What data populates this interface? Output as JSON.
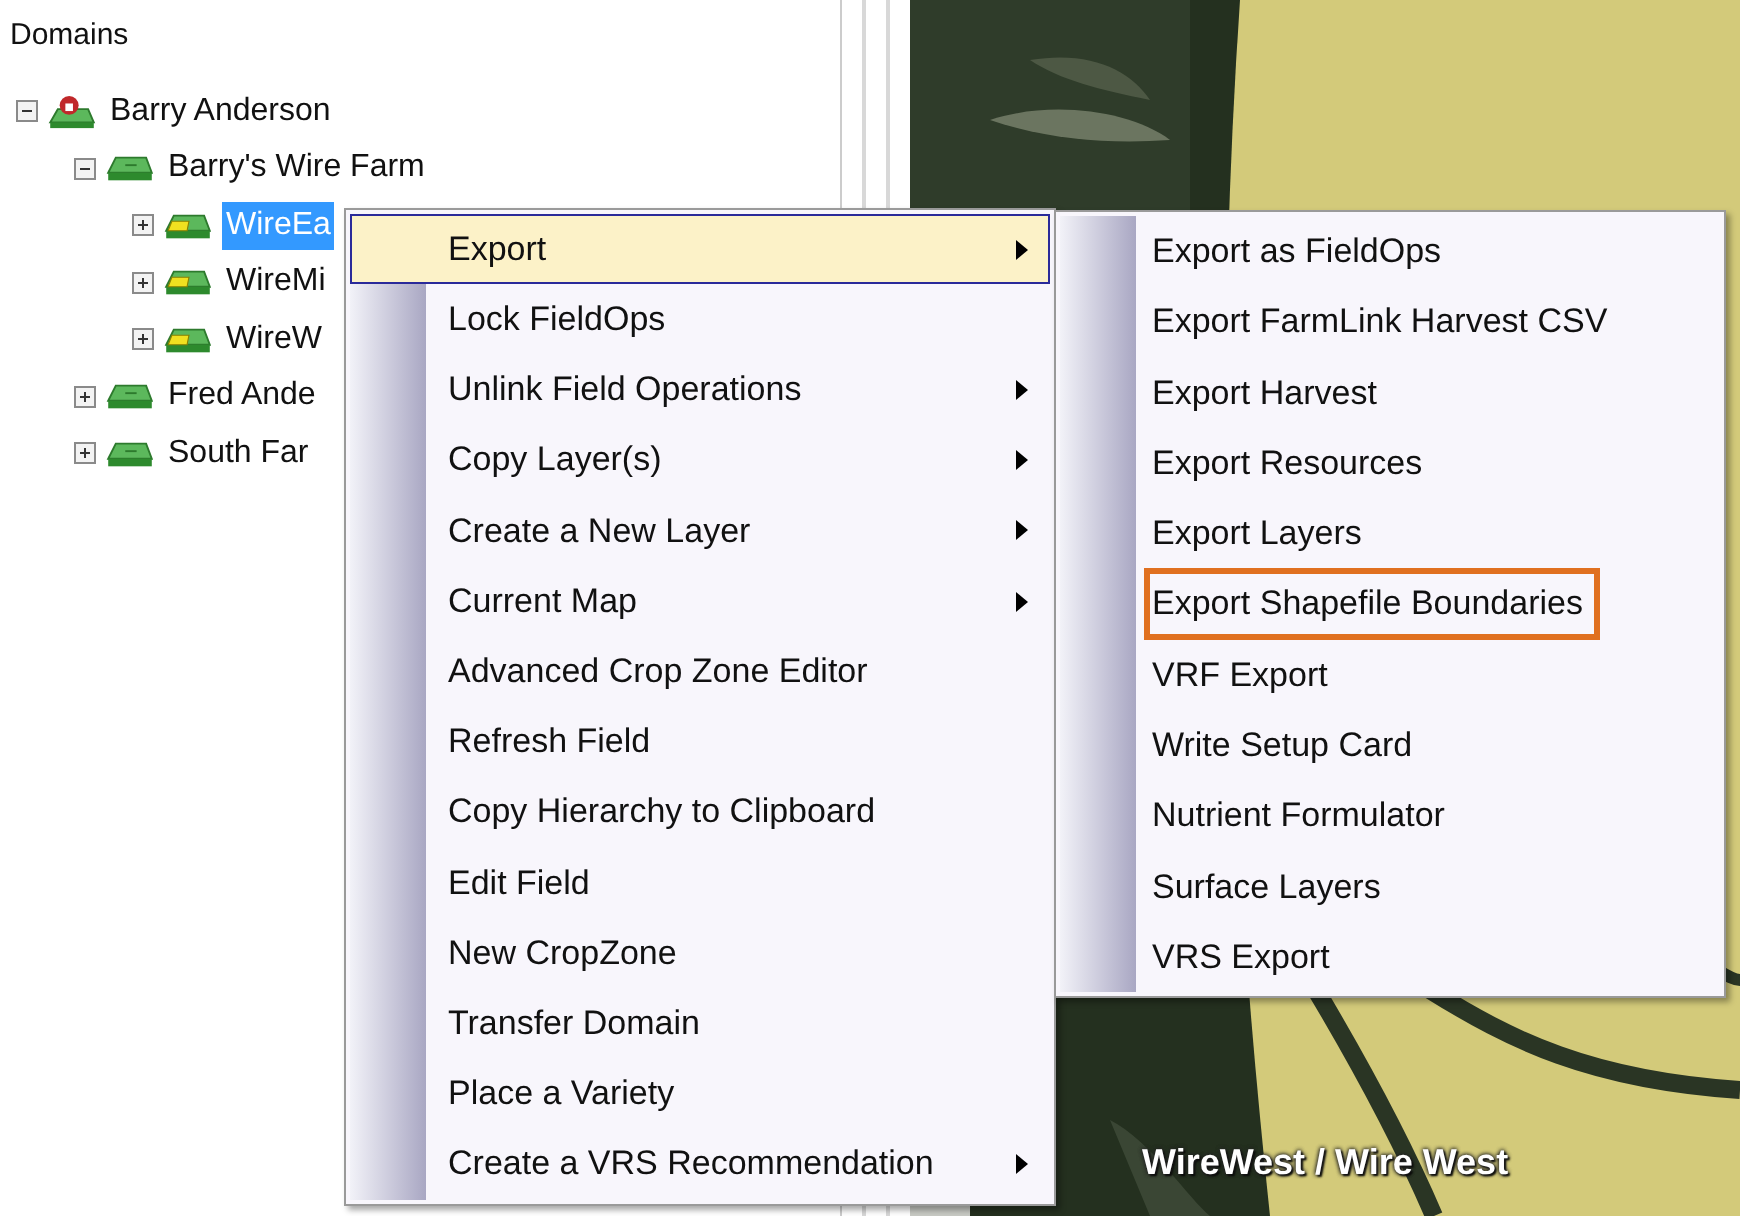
{
  "tree": {
    "title": "Domains",
    "nodes": [
      {
        "label": "Barry Anderson",
        "kind": "grower",
        "expanded": true,
        "selected": false,
        "children": [
          {
            "label": "Barry's Wire Farm",
            "kind": "farm",
            "expanded": true,
            "selected": false,
            "children": [
              {
                "label": "WireEa",
                "kind": "field",
                "expanded": false,
                "selected": true
              },
              {
                "label": "WireMi",
                "kind": "field",
                "expanded": false,
                "selected": false
              },
              {
                "label": "WireW",
                "kind": "field",
                "expanded": false,
                "selected": false
              }
            ]
          },
          {
            "label": "Fred Ande",
            "kind": "farm",
            "expanded": false,
            "selected": false
          },
          {
            "label": "South Far",
            "kind": "farm",
            "expanded": false,
            "selected": false
          }
        ]
      }
    ]
  },
  "context_menu": {
    "items": [
      {
        "label": "Export",
        "submenu": true,
        "selected": true
      },
      {
        "label": "Lock FieldOps",
        "submenu": false,
        "selected": false
      },
      {
        "label": "Unlink Field Operations",
        "submenu": true,
        "selected": false
      },
      {
        "label": "Copy Layer(s)",
        "submenu": true,
        "selected": false
      },
      {
        "label": "Create a New Layer",
        "submenu": true,
        "selected": false
      },
      {
        "label": "Current Map",
        "submenu": true,
        "selected": false
      },
      {
        "label": "Advanced Crop Zone Editor",
        "submenu": false,
        "selected": false
      },
      {
        "label": "Refresh Field",
        "submenu": false,
        "selected": false
      },
      {
        "label": "Copy Hierarchy to Clipboard",
        "submenu": false,
        "selected": false
      },
      {
        "label": "Edit Field",
        "submenu": false,
        "selected": false
      },
      {
        "label": "New CropZone",
        "submenu": false,
        "selected": false
      },
      {
        "label": "Transfer Domain",
        "submenu": false,
        "selected": false
      },
      {
        "label": "Place a Variety",
        "submenu": false,
        "selected": false
      },
      {
        "label": "Create a VRS Recommendation",
        "submenu": true,
        "selected": false
      }
    ]
  },
  "export_submenu": {
    "items": [
      {
        "label": "Export as FieldOps",
        "outlined": false
      },
      {
        "label": "Export FarmLink Harvest CSV",
        "outlined": false
      },
      {
        "label": "Export Harvest",
        "outlined": false
      },
      {
        "label": "Export Resources",
        "outlined": false
      },
      {
        "label": "Export Layers",
        "outlined": false
      },
      {
        "label": "Export Shapefile Boundaries",
        "outlined": true
      },
      {
        "label": "VRF Export",
        "outlined": false
      },
      {
        "label": "Write Setup Card",
        "outlined": false
      },
      {
        "label": "Nutrient Formulator",
        "outlined": false
      },
      {
        "label": "Surface Layers",
        "outlined": false
      },
      {
        "label": "VRS Export",
        "outlined": false
      }
    ]
  },
  "map": {
    "field_label": "WireWest / Wire West"
  }
}
